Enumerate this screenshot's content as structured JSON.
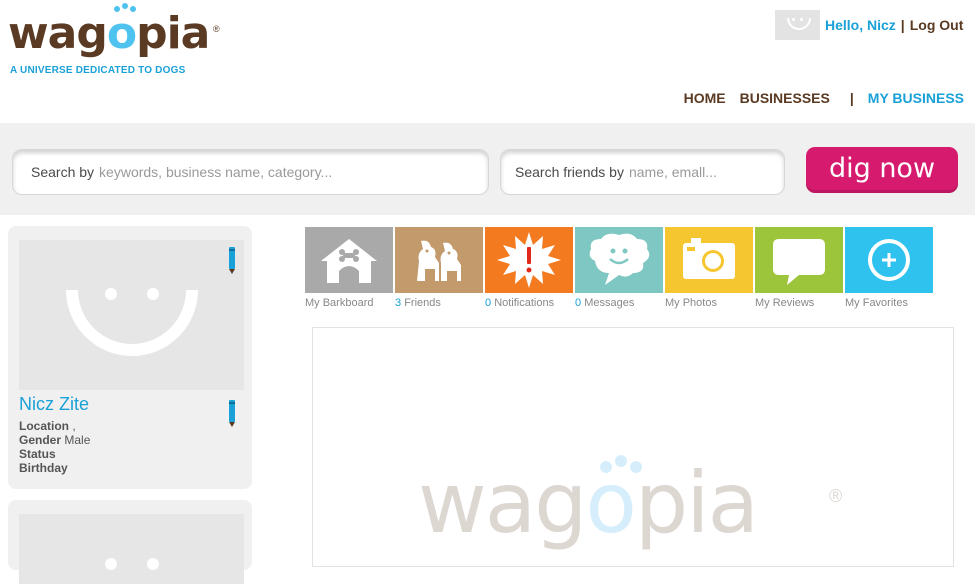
{
  "header": {
    "logo": {
      "wordmark_before_o": "wag",
      "wordmark_o": "o",
      "wordmark_after_o": "pia",
      "registered": "®",
      "tagline": "A UNIVERSE DEDICATED TO DOGS"
    },
    "user": {
      "greeting": "Hello, Nicz",
      "separator": "|",
      "logout": "Log Out"
    },
    "nav": {
      "home": "HOME",
      "businesses": "BUSINESSES",
      "divider": "|",
      "my_business": "MY BUSINESS"
    }
  },
  "search": {
    "business": {
      "label": "Search by",
      "placeholder": "keywords, business name, category..."
    },
    "friends": {
      "label": "Search friends by",
      "placeholder": "name, emall..."
    },
    "submit_label": "dig now"
  },
  "profile": {
    "name": "Nicz Zite",
    "location_label": "Location",
    "location_value": ",",
    "gender_label": "Gender",
    "gender_value": "Male",
    "status_label": "Status",
    "birthday_label": "Birthday"
  },
  "tiles": [
    {
      "count": "",
      "label": "My Barkboard",
      "icon": "doghouse-icon",
      "color": "#a9a9a9"
    },
    {
      "count": "3",
      "label": "Friends",
      "icon": "dogs-icon",
      "color": "#c39a6b"
    },
    {
      "count": "0",
      "label": "Notifications",
      "icon": "alert-burst-icon",
      "color": "#f47a1f"
    },
    {
      "count": "0",
      "label": "Messages",
      "icon": "speech-cloud-icon",
      "color": "#7ec7c3"
    },
    {
      "count": "",
      "label": "My Photos",
      "icon": "camera-icon",
      "color": "#f6c631"
    },
    {
      "count": "",
      "label": "My Reviews",
      "icon": "speech-bubble-icon",
      "color": "#9cc53b"
    },
    {
      "count": "",
      "label": "My Favorites",
      "icon": "plus-badge-icon",
      "color": "#2fc2ee"
    }
  ],
  "colors": {
    "brand_brown": "#5a3a22",
    "brand_blue": "#1aa1d8",
    "button_pink": "#d61b6e"
  }
}
